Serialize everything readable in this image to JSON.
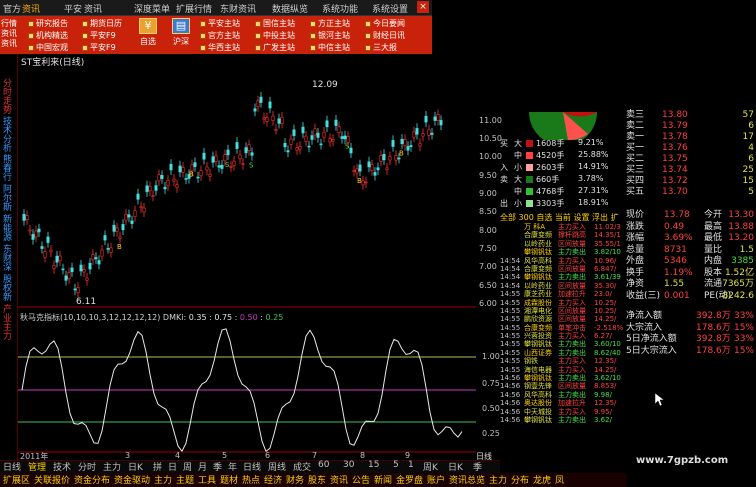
{
  "menubar": {
    "items": [
      "官方",
      "资讯",
      "平安",
      "资讯",
      "深度菜单",
      "扩展行情",
      "东财资讯",
      "数据纵览",
      "系统功能",
      "系统设置"
    ],
    "active_index": 1
  },
  "toolbar": {
    "left_col": [
      "行情",
      "资讯",
      "资讯",
      "资讯",
      "资讯"
    ],
    "cells": [
      "研究报告",
      "期货日历",
      "平安主站",
      "国信主站",
      "方正主站",
      "今日要闻",
      "机构精选",
      "平安F9",
      "官方主站",
      "中投主站",
      "银河主站",
      "财经日讯",
      "中国宏观",
      "平安F9",
      "华西主站",
      "广发主站",
      "中信主站",
      "三大报"
    ],
    "big_buttons": [
      "自选",
      "沪深"
    ]
  },
  "sidebar": {
    "items": [
      "分时走势",
      "技术分析",
      "熊春行",
      "阿尔斯",
      "新能源",
      "东财深",
      "股权新",
      "产业主力"
    ]
  },
  "chart": {
    "title": "ST宝利来(日线)",
    "high_label": "12.09",
    "low_label": "6.11",
    "y_ticks": [
      "11.00",
      "10.50",
      "10.00",
      "9.50",
      "9.00",
      "8.50",
      "8.00",
      "7.50",
      "7.00",
      "6.50",
      "6.00"
    ]
  },
  "indicator": {
    "label": "秋马克指标(10,10,10,3,12,12,12,12) DMKi:",
    "v1": "0.35",
    "v2": "0.75",
    "v3": "0.50",
    "v4": "0.25",
    "y_ticks": [
      "1.00",
      "0.75",
      "0.50",
      "0.25"
    ],
    "x_ticks": [
      "2011年",
      "",
      "3",
      "4",
      "5",
      "6",
      "7",
      "8",
      "9",
      "日线"
    ]
  },
  "pie": {
    "rows": [
      {
        "side": "买",
        "size": "大",
        "vol": "1608手",
        "pct": "9.21%",
        "color": "#c01010"
      },
      {
        "side": "",
        "size": "中",
        "vol": "4520手",
        "pct": "25.88%",
        "color": "#ff4040"
      },
      {
        "side": "入",
        "size": "小",
        "vol": "2603手",
        "pct": "14.91%",
        "color": "#ffa0a0"
      },
      {
        "side": "卖",
        "size": "大",
        "vol": "660手",
        "pct": "3.78%",
        "color": "#1a7a1a"
      },
      {
        "side": "",
        "size": "中",
        "vol": "4768手",
        "pct": "27.31%",
        "color": "#30c030"
      },
      {
        "side": "出",
        "size": "小",
        "vol": "3303手",
        "pct": "18.91%",
        "color": "#90e090"
      }
    ]
  },
  "order_book": [
    {
      "label": "卖三",
      "price": "13.80",
      "vol": "57"
    },
    {
      "label": "卖二",
      "price": "13.79",
      "vol": "6"
    },
    {
      "label": "卖一",
      "price": "13.78",
      "vol": "17"
    },
    {
      "label": "买一",
      "price": "13.76",
      "vol": "4"
    },
    {
      "label": "买二",
      "price": "13.75",
      "vol": "6"
    },
    {
      "label": "买三",
      "price": "13.74",
      "vol": "25"
    },
    {
      "label": "买四",
      "price": "13.72",
      "vol": "15"
    },
    {
      "label": "买五",
      "price": "13.70",
      "vol": "5"
    }
  ],
  "filter_tabs": [
    "全部",
    "300",
    "自选",
    "当前",
    "设置",
    "浮出",
    "扩"
  ],
  "stats": [
    {
      "k": "现价",
      "v": "13.78",
      "k2": "今开",
      "v2": "13.30"
    },
    {
      "k": "涨跌",
      "v": "0.49",
      "k2": "最高",
      "v2": "13.88"
    },
    {
      "k": "涨幅",
      "v": "3.69%",
      "k2": "最低",
      "v2": "13.20"
    },
    {
      "k": "总量",
      "v": "8731",
      "k2": "量比",
      "v2": "1.5"
    },
    {
      "k": "外盘",
      "v": "5346",
      "k2": "内盘",
      "v2": "3385"
    },
    {
      "k": "换手",
      "v": "1.19%",
      "k2": "股本",
      "v2": "1.52亿"
    },
    {
      "k": "净资",
      "v": "1.55",
      "k2": "流通",
      "v2": "7365万"
    },
    {
      "k": "收益(三)",
      "v": "0.001",
      "k2": "PE(动)",
      "v2": "8242.6"
    }
  ],
  "flows": [
    {
      "k": "净流入额",
      "v": "392.8万",
      "p": "33%"
    },
    {
      "k": "大宗流入",
      "v": "178.6万",
      "p": "15%"
    },
    {
      "k": "5日净流入额",
      "v": "392.8万",
      "p": "33%"
    },
    {
      "k": "5日大宗流入",
      "v": "178.6万",
      "p": "15%"
    }
  ],
  "ticker": [
    {
      "t": "",
      "n": "万 科A",
      "k": "主力买入",
      "v": "11.02/3"
    },
    {
      "t": "",
      "n": "合康变频",
      "k": "撑杆跳高",
      "v": "14.35/1"
    },
    {
      "t": "",
      "n": "以岭药业",
      "k": "区间放量",
      "v": "35.55/1"
    },
    {
      "t": "",
      "n": "攀钢钒钛",
      "k": "主力卖出",
      "v": "3.82/10"
    },
    {
      "t": "14:54",
      "n": "风华高科",
      "k": "主力买入",
      "v": "10.96/"
    },
    {
      "t": "14:54",
      "n": "合康变频",
      "k": "区间放量",
      "v": "6.847/"
    },
    {
      "t": "14:54",
      "n": "攀钢钒钛",
      "k": "主力卖出",
      "v": "3.61/39"
    },
    {
      "t": "14:54",
      "n": "以岭药业",
      "k": "区间放量",
      "v": "35.30/"
    },
    {
      "t": "14:55",
      "n": "康芝药业",
      "k": "加速拉升",
      "v": "23.0/"
    },
    {
      "t": "14:55",
      "n": "成霖股份",
      "k": "主力买入",
      "v": "10.25/"
    },
    {
      "t": "14:55",
      "n": "湘潭电化",
      "k": "区间放量",
      "v": "10.25/"
    },
    {
      "t": "14:55",
      "n": "鹏欣资源",
      "k": "区间放量",
      "v": "14.25/"
    },
    {
      "t": "14:55",
      "n": "合康变频",
      "k": "单笔冲击",
      "v": "-2.518%"
    },
    {
      "t": "14:55",
      "n": "兴蓉投资",
      "k": "主力买入",
      "v": "6.27/"
    },
    {
      "t": "14:55",
      "n": "攀钢钒钛",
      "k": "主力卖出",
      "v": "3.60/10"
    },
    {
      "t": "14:55",
      "n": "山西证券",
      "k": "主力卖出",
      "v": "8.62/40"
    },
    {
      "t": "14:55",
      "n": "钢铁",
      "k": "主力买入",
      "v": "12.35/"
    },
    {
      "t": "14:55",
      "n": "海信电器",
      "k": "主力买入",
      "v": "14.25/"
    },
    {
      "t": "14:56",
      "n": "攀钢钒钛",
      "k": "主力卖出",
      "v": "3.62/10"
    },
    {
      "t": "14:56",
      "n": "钢壹先锋",
      "k": "区间放量",
      "v": "8.853/"
    },
    {
      "t": "14:56",
      "n": "风华高科",
      "k": "主力卖出",
      "v": "9.98/"
    },
    {
      "t": "14:56",
      "n": "奥达股份",
      "k": "加速拉升",
      "v": "12.35/"
    },
    {
      "t": "14:56",
      "n": "中天城投",
      "k": "主力买入",
      "v": "9.95/"
    },
    {
      "t": "14:56",
      "n": "攀钢钒钛",
      "k": "主力卖出",
      "v": "3.62/"
    }
  ],
  "bottom_tabs1": [
    "日线",
    "管理",
    "技术",
    "分时",
    "主力",
    "日K",
    "拼",
    "日",
    "周",
    "月",
    "季",
    "年",
    "日线",
    "周线",
    "成交",
    "60",
    "30",
    "15",
    "5",
    "1",
    "周K",
    "日K",
    "季"
  ],
  "bottom_tabs2": [
    "扩展区",
    "关联报价",
    "资金分布",
    "资金驱动",
    "主力",
    "主题",
    "工具",
    "题材",
    "热点",
    "经济",
    "财务",
    "股东",
    "资讯",
    "公告",
    "新闻",
    "金罗盘",
    "账户",
    "资讯总览",
    "主力",
    "分布",
    "龙虎",
    "凤"
  ],
  "watermark": "www.7gpzb.com"
}
